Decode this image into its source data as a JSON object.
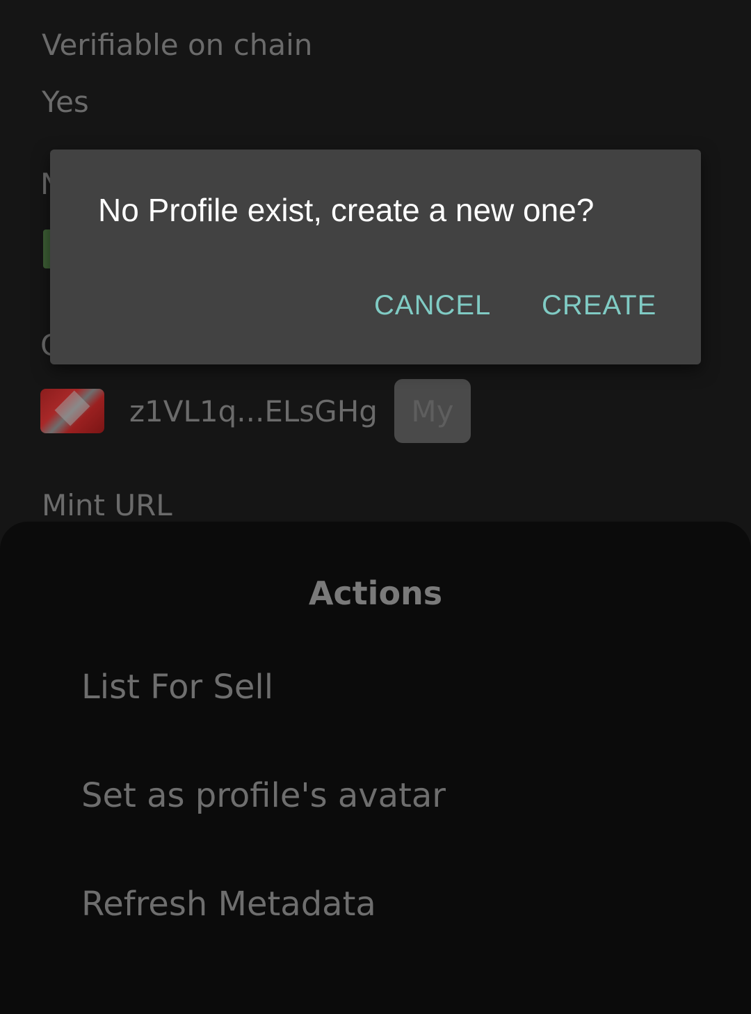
{
  "background": {
    "verifiable_label": "Verifiable on chain",
    "verifiable_value": "Yes",
    "partial_label_1": "N",
    "partial_label_2": "C",
    "owner": {
      "address": "z1VL1q...ELsGHg",
      "badge": "My"
    },
    "mint_url_label": "Mint URL"
  },
  "actions_sheet": {
    "title": "Actions",
    "items": [
      {
        "label": "List For Sell"
      },
      {
        "label": "Set as profile's avatar"
      },
      {
        "label": "Refresh Metadata"
      }
    ]
  },
  "dialog": {
    "message": "No Profile exist, create a new one?",
    "cancel_label": "CANCEL",
    "create_label": "CREATE",
    "accent_color": "#80cbc4"
  }
}
